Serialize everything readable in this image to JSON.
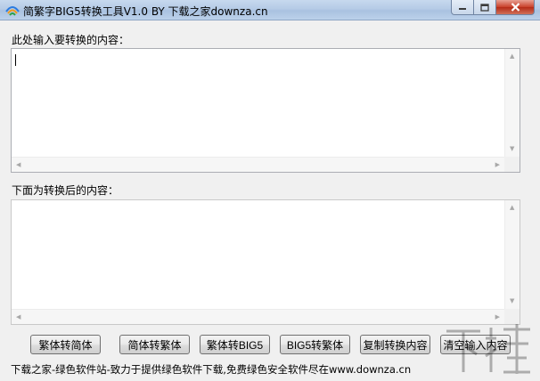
{
  "window": {
    "title": "简繁字BIG5转换工具V1.0 BY 下载之家downza.cn",
    "controls": {
      "minimize": "minimize-icon",
      "maximize": "maximize-icon",
      "close": "close-icon"
    }
  },
  "input": {
    "label": "此处输入要转换的内容：",
    "value": ""
  },
  "output": {
    "label": "下面为转换后的内容：",
    "value": ""
  },
  "buttons": [
    {
      "label": "繁体转简体"
    },
    {
      "label": "简体转繁体"
    },
    {
      "label": "繁体转BIG5"
    },
    {
      "label": "BIG5转繁体"
    },
    {
      "label": "复制转换内容"
    },
    {
      "label": "清空输入内容"
    }
  ],
  "footer": {
    "text": "下载之家-绿色软件站-致力于提供绿色软件下载,免费绿色安全软件尽在www.downza.cn"
  },
  "colors": {
    "title_bar": "#b5cbe6",
    "close_button": "#c9402a",
    "window_bg": "#f0f0f0"
  }
}
